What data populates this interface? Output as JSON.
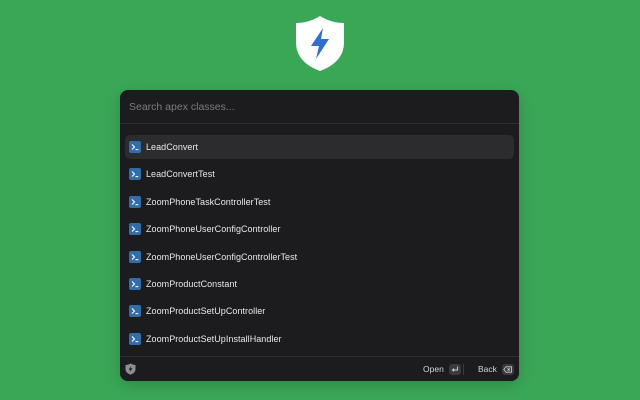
{
  "logo": {
    "icon": "lightning-shield-icon",
    "accent": "#2f6fd1"
  },
  "search": {
    "placeholder": "Search apex classes...",
    "value": ""
  },
  "results": [
    {
      "label": "LeadConvert",
      "icon": "terminal-icon",
      "selected": true
    },
    {
      "label": "LeadConvertTest",
      "icon": "terminal-icon"
    },
    {
      "label": "ZoomPhoneTaskControllerTest",
      "icon": "terminal-icon"
    },
    {
      "label": "ZoomPhoneUserConfigController",
      "icon": "terminal-icon"
    },
    {
      "label": "ZoomPhoneUserConfigControllerTest",
      "icon": "terminal-icon"
    },
    {
      "label": "ZoomProductConstant",
      "icon": "terminal-icon"
    },
    {
      "label": "ZoomProductSetUpController",
      "icon": "terminal-icon"
    },
    {
      "label": "ZoomProductSetUpInstallHandler",
      "icon": "terminal-icon"
    }
  ],
  "footer": {
    "open_label": "Open",
    "open_key_icon": "return-key-icon",
    "back_label": "Back",
    "back_key_icon": "backspace-key-icon"
  },
  "colors": {
    "background": "#3aa757",
    "panel": "#1c1c1e",
    "selected_row": "#2c2c2f",
    "item_icon": "#2f6ea8"
  }
}
